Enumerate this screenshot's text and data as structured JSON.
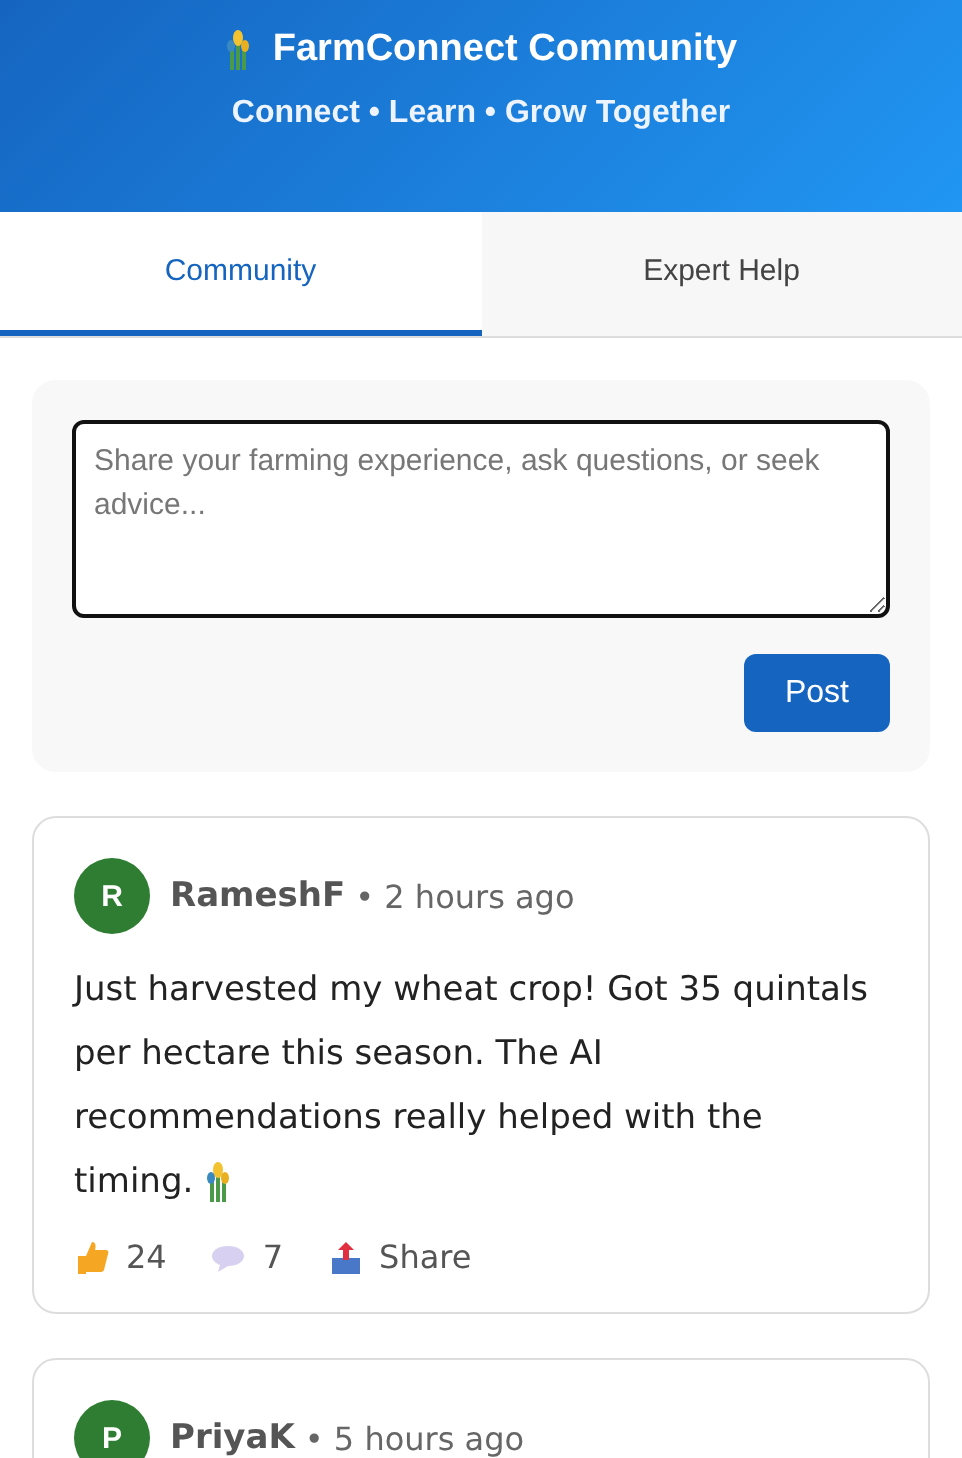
{
  "header": {
    "title": "FarmConnect Community",
    "subtitle": "Connect • Learn • Grow Together"
  },
  "tabs": [
    {
      "label": "Community",
      "selected": true
    },
    {
      "label": "Expert Help",
      "selected": false
    }
  ],
  "composer": {
    "placeholder": "Share your farming experience, ask questions, or seek advice...",
    "button": "Post"
  },
  "posts": [
    {
      "initial": "R",
      "author": "RameshF",
      "time": "• 2 hours ago",
      "body": "Just harvested my wheat crop! Got 35 quintals per hectare this season. The AI recommendations really helped with the timing.",
      "likes": "24",
      "comments": "7",
      "share": "Share"
    },
    {
      "initial": "P",
      "author": "PriyaK",
      "time": "• 5 hours ago"
    }
  ]
}
